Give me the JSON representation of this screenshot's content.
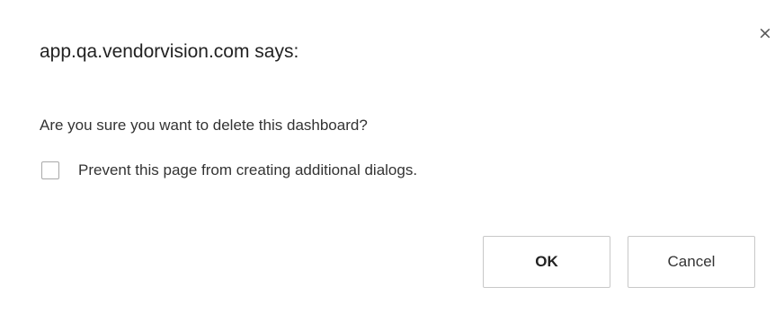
{
  "dialog": {
    "title": "app.qa.vendorvision.com says:",
    "message": "Are you sure you want to delete this dashboard?",
    "prevent_label": "Prevent this page from creating additional dialogs.",
    "prevent_checked": false,
    "close_icon": "×",
    "ok_label": "OK",
    "cancel_label": "Cancel"
  },
  "icons": {
    "close": "close-icon"
  }
}
